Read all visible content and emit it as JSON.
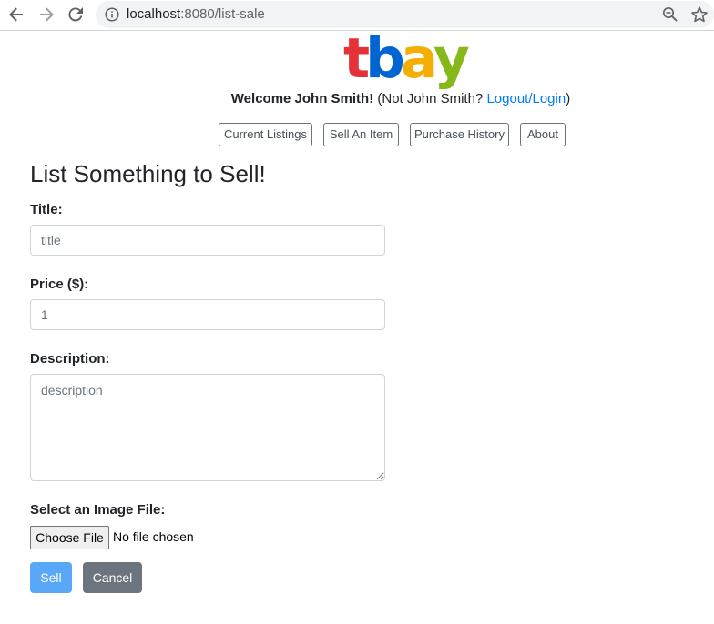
{
  "browser": {
    "url_host": "localhost",
    "url_rest": ":8080/list-sale"
  },
  "brand": {
    "letters": [
      "t",
      "b",
      "a",
      "y"
    ],
    "colors": [
      "#e53238",
      "#0064d2",
      "#f5af02",
      "#86b817"
    ]
  },
  "header": {
    "welcome_bold": "Welcome John Smith!",
    "not_user": "(Not John Smith?",
    "logout_link": "Logout/Login",
    "close_paren": ")"
  },
  "nav": {
    "items": [
      "Current Listings",
      "Sell An Item",
      "Purchase History",
      "About"
    ]
  },
  "form": {
    "heading": "List Something to Sell!",
    "title_label": "Title:",
    "title_placeholder": "title",
    "price_label": "Price ($):",
    "price_placeholder": "1",
    "description_label": "Description:",
    "description_placeholder": "description",
    "image_label": "Select an Image File:",
    "choose_file": "Choose File",
    "no_file": "No file chosen",
    "sell": "Sell",
    "cancel": "Cancel"
  },
  "colors": {
    "link": "#007bff",
    "sell_button": "#59a7f7",
    "cancel_button": "#6c757d"
  },
  "icons": [
    "back-arrow-icon",
    "forward-arrow-icon",
    "reload-icon",
    "info-icon",
    "zoom-icon",
    "star-icon"
  ]
}
